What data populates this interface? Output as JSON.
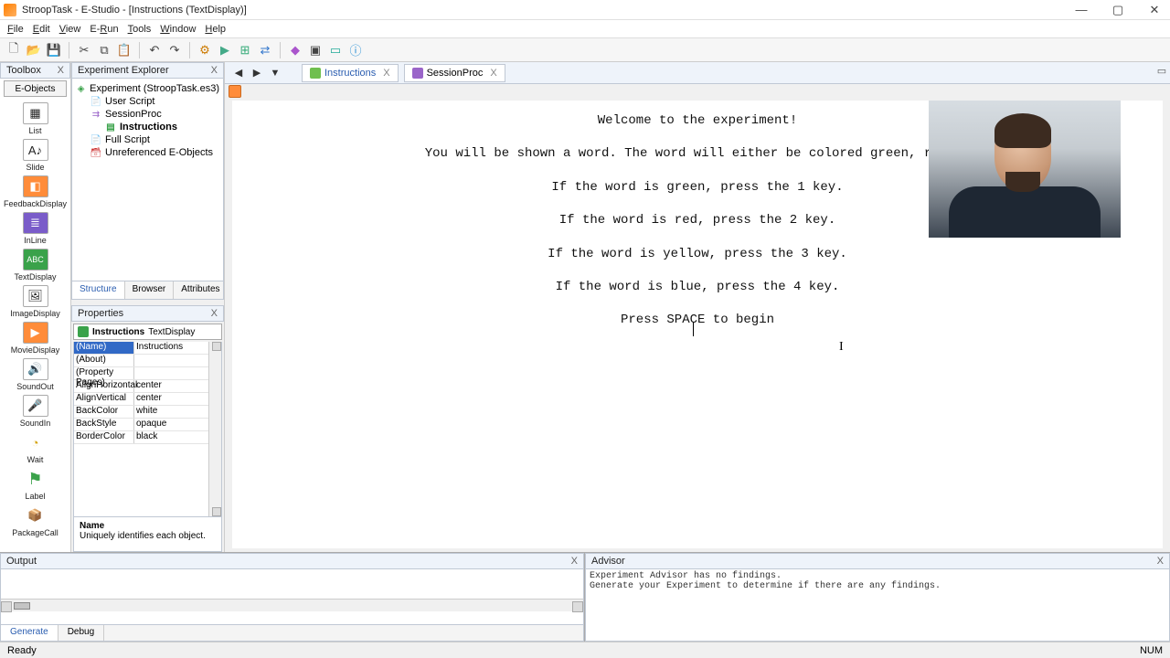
{
  "window": {
    "title": "StroopTask - E-Studio - [Instructions  (TextDisplay)]",
    "min": "—",
    "max": "▢",
    "close": "✕"
  },
  "menu": {
    "file": "File",
    "edit": "Edit",
    "view": "View",
    "erun": "E-Run",
    "tools": "Tools",
    "window": "Window",
    "help": "Help"
  },
  "toolbox": {
    "title": "Toolbox",
    "combo": "E-Objects",
    "items": [
      {
        "icon": "▦",
        "label": "List"
      },
      {
        "icon": "A♪",
        "label": "Slide"
      },
      {
        "icon": "◧",
        "label": "FeedbackDisplay"
      },
      {
        "icon": "≣",
        "label": "InLine"
      },
      {
        "icon": "ABC",
        "label": "TextDisplay"
      },
      {
        "icon": "🖼",
        "label": "ImageDisplay"
      },
      {
        "icon": "▶",
        "label": "MovieDisplay"
      },
      {
        "icon": "🔊",
        "label": "SoundOut"
      },
      {
        "icon": "🎤",
        "label": "SoundIn"
      },
      {
        "icon": "◔",
        "label": "Wait"
      },
      {
        "icon": "⚑",
        "label": "Label"
      },
      {
        "icon": "📦",
        "label": "PackageCall"
      }
    ]
  },
  "explorer": {
    "title": "Experiment Explorer",
    "root": "Experiment (StroopTask.es3)",
    "nodes": [
      {
        "label": "User Script"
      },
      {
        "label": "SessionProc"
      },
      {
        "label": "Instructions",
        "bold": true
      },
      {
        "label": "Full Script"
      },
      {
        "label": "Unreferenced E-Objects"
      }
    ],
    "tabs": {
      "a": "Structure",
      "b": "Browser",
      "c": "Attributes"
    }
  },
  "properties": {
    "title": "Properties",
    "combo_name": "Instructions",
    "combo_type": "TextDisplay",
    "rows": [
      {
        "k": "(Name)",
        "v": "Instructions",
        "sel": true
      },
      {
        "k": "(About)",
        "v": ""
      },
      {
        "k": "(Property Pages)",
        "v": ""
      },
      {
        "k": "AlignHorizontal",
        "v": "center"
      },
      {
        "k": "AlignVertical",
        "v": "center"
      },
      {
        "k": "BackColor",
        "v": "white"
      },
      {
        "k": "BackStyle",
        "v": "opaque"
      },
      {
        "k": "BorderColor",
        "v": "black"
      }
    ],
    "desc_name": "Name",
    "desc_text": "Uniquely identifies each object."
  },
  "editor": {
    "nav": {
      "back": "◀",
      "play": "▶",
      "down": "▼"
    },
    "tab1": "Instructions",
    "tab2": "SessionProc",
    "tab_close": "X",
    "lines": [
      "Welcome to the experiment!",
      "You will be shown a word. The word will either be colored green, red, y",
      "If the word is green, press the 1 key.",
      "If the word is red, press the 2 key.",
      "If the word is yellow, press the 3 key.",
      "If the word is blue, press the 4 key.",
      "Press SPACE to begin"
    ]
  },
  "output": {
    "title": "Output",
    "tabs": {
      "a": "Generate",
      "b": "Debug"
    }
  },
  "advisor": {
    "title": "Advisor",
    "line1": "Experiment Advisor has no findings.",
    "line2": "Generate your Experiment to determine if there are any findings."
  },
  "status": {
    "left": "Ready",
    "num": "NUM"
  }
}
